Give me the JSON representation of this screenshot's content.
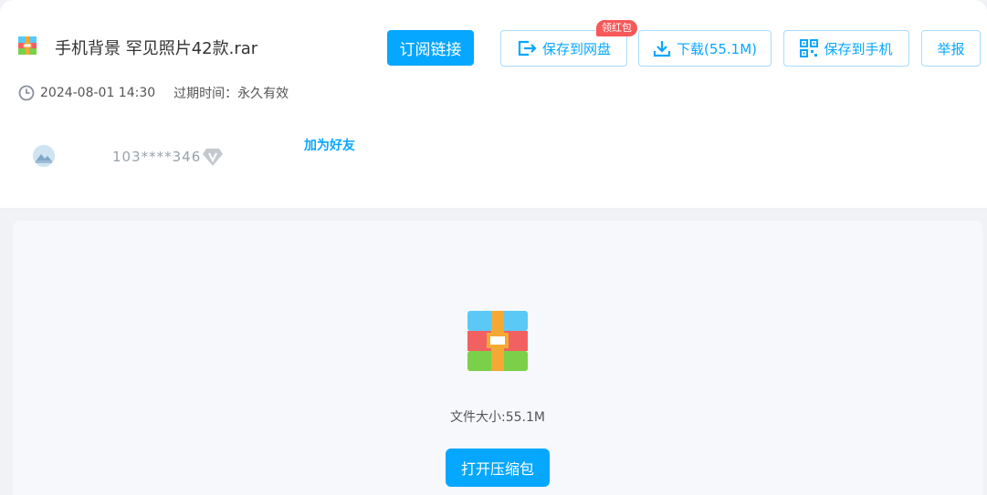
{
  "file": {
    "title": "手机背景 罕见照片42款.rar",
    "icon": "winrar-archive-icon"
  },
  "actions": {
    "subscribe_label": "订阅链接",
    "save_disk_label": "保存到网盘",
    "save_disk_badge": "领红包",
    "download_label": "下载(55.1M)",
    "save_phone_label": "保存到手机",
    "report_label": "举报"
  },
  "meta": {
    "date": "2024-08-01 14:30",
    "expire": "过期时间：永久有效"
  },
  "user": {
    "name": "103****346",
    "add_friend_label": "加为好友"
  },
  "preview": {
    "file_size": "文件大小:55.1M",
    "open_label": "打开压缩包"
  },
  "colors": {
    "accent": "#06a7ff",
    "badge": "#f85859"
  }
}
